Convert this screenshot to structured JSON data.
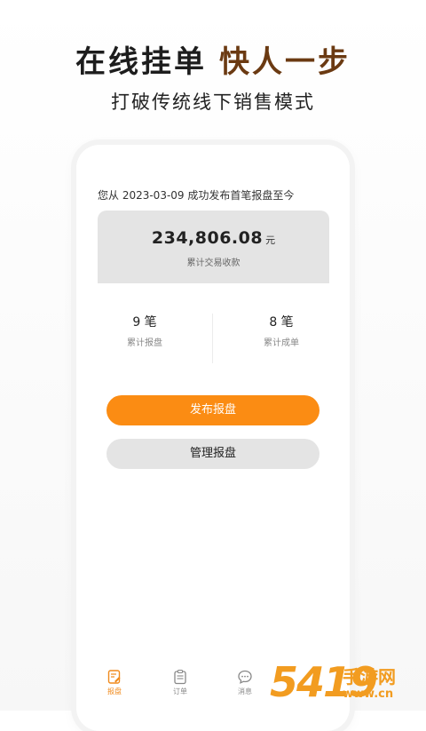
{
  "hero": {
    "headline_part1": "在线挂单",
    "headline_part2": "快人一步",
    "subline": "打破传统线下销售模式"
  },
  "summary": {
    "since_text": "您从 2023-03-09 成功发布首笔报盘至今",
    "amount": "234,806.08",
    "unit": "元",
    "amount_label": "累计交易收款"
  },
  "stats": [
    {
      "value": "9 笔",
      "label": "累计报盘"
    },
    {
      "value": "8 笔",
      "label": "累计成单"
    }
  ],
  "actions": {
    "publish_label": "发布报盘",
    "manage_label": "管理报盘"
  },
  "tabbar": [
    {
      "label": "报盘",
      "icon": "edit-doc-icon",
      "active": true
    },
    {
      "label": "订单",
      "icon": "clipboard-icon",
      "active": false
    },
    {
      "label": "消息",
      "icon": "chat-bubble-icon",
      "active": false
    }
  ],
  "watermark": {
    "number": "5419",
    "text": "手游网",
    "url": "www.cn"
  },
  "colors": {
    "accent": "#fb8c13",
    "brown_headline": "#6b3a12",
    "watermark": "#f29c20"
  }
}
